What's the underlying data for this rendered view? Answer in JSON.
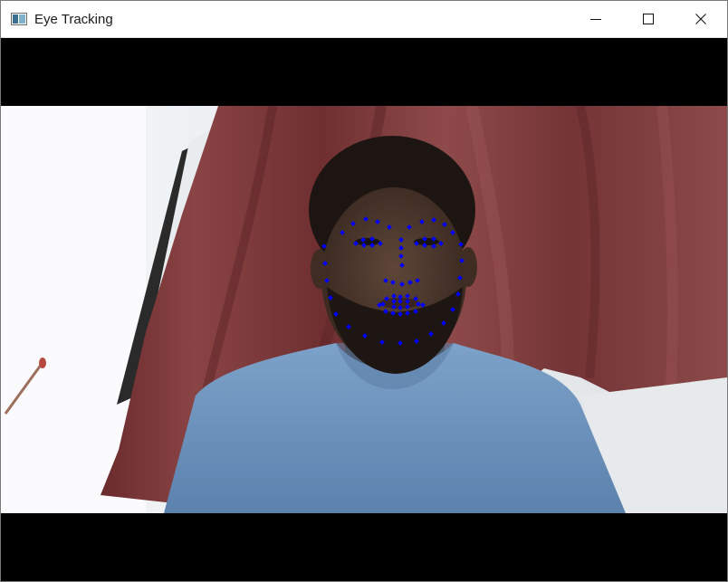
{
  "window": {
    "title": "Eye Tracking",
    "controls": {
      "minimize": "minimize",
      "maximize": "maximize",
      "close": "close"
    }
  },
  "video": {
    "landmark_color": "#0000ff",
    "landmark_count": 68
  }
}
